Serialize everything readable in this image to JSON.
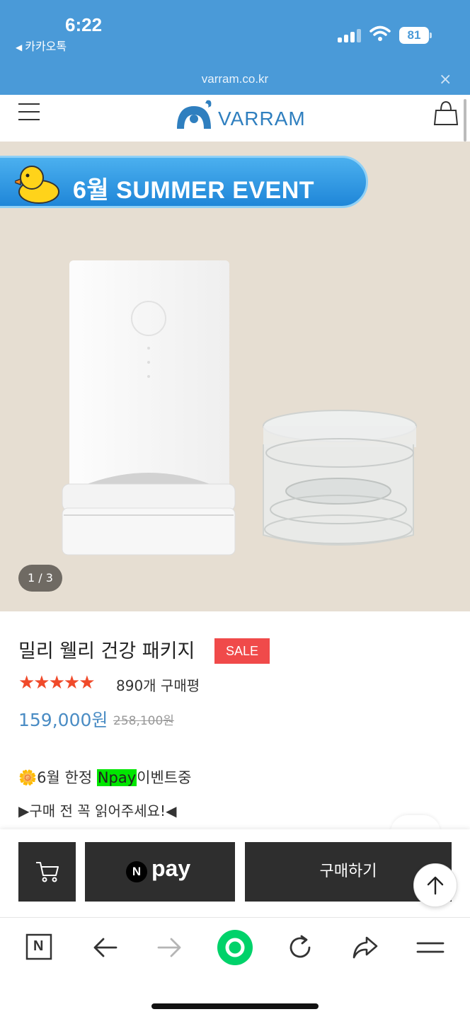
{
  "status_bar": {
    "time": "6:22",
    "back_app": "카카오톡",
    "battery": "81"
  },
  "browser": {
    "url": "varram.co.kr",
    "close_glyph": "×"
  },
  "site_header": {
    "logo_text": "VARRAM",
    "menu_icon": "hamburger-icon",
    "bag_icon": "shopping-bag-icon"
  },
  "hero": {
    "event_banner": "6월 SUMMER EVENT",
    "pager": "1 / 3"
  },
  "product": {
    "title": "밀리 웰리 건강 패키지",
    "badge": "SALE",
    "rating_stars": "★★★★★",
    "rating": 5,
    "review_count": "890개 구매평",
    "price": "159,000원",
    "original_price": "258,100원"
  },
  "promo": {
    "flower": "🌼",
    "line1_prefix": "6월 한정 ",
    "line1_highlight": "Npay",
    "line1_suffix": "이벤트중",
    "line2": "▶구매 전 꼭 읽어주세요!◀"
  },
  "actions": {
    "cart_icon": "cart-icon",
    "npay_logo_letter": "N",
    "npay_logo_word": "pay",
    "buy_label": "구매하기",
    "top_icon": "arrow-up-icon"
  },
  "toolbar": {
    "icons": [
      "naver-n-icon",
      "back-arrow-icon",
      "forward-arrow-icon",
      "green-dot-icon",
      "reload-icon",
      "share-icon",
      "menu-icon"
    ],
    "naver_letter": "N"
  },
  "colors": {
    "status_blue": "#4a9ad8",
    "sale_red": "#f04a4a",
    "star_orange": "#f04a2a",
    "price_blue": "#4a8cc4",
    "npay_green": "#00e600",
    "button_dark": "#2e2e2e",
    "hero_bg": "#e6ded2"
  }
}
